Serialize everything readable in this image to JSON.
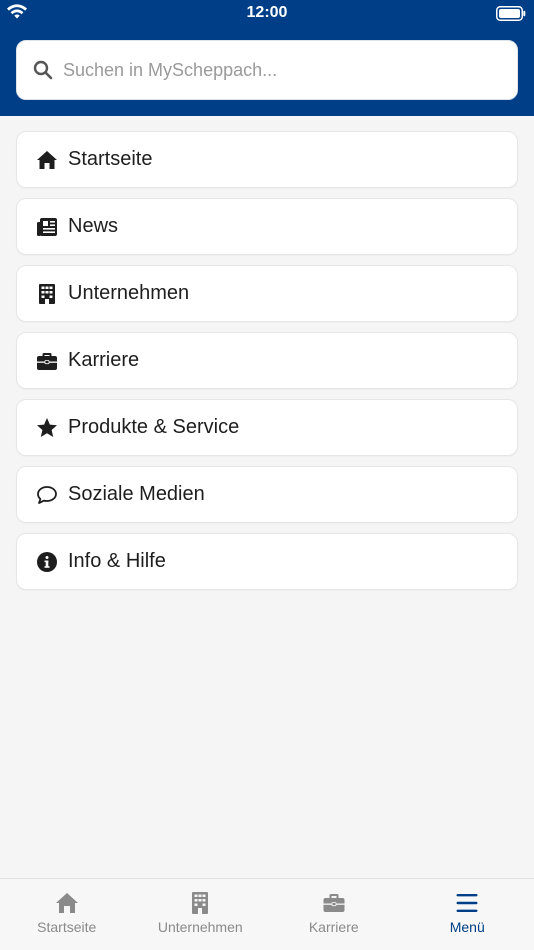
{
  "status_bar": {
    "time": "12:00"
  },
  "search": {
    "placeholder": "Suchen in MyScheppach..."
  },
  "menu": {
    "items": [
      {
        "label": "Startseite",
        "icon": "home-icon"
      },
      {
        "label": "News",
        "icon": "newspaper-icon"
      },
      {
        "label": "Unternehmen",
        "icon": "building-icon"
      },
      {
        "label": "Karriere",
        "icon": "briefcase-icon"
      },
      {
        "label": "Produkte & Service",
        "icon": "star-icon"
      },
      {
        "label": "Soziale Medien",
        "icon": "chat-bubble-icon"
      },
      {
        "label": "Info & Hilfe",
        "icon": "info-icon"
      }
    ]
  },
  "tabbar": {
    "tabs": [
      {
        "label": "Startseite",
        "icon": "home-icon",
        "active": false
      },
      {
        "label": "Unternehmen",
        "icon": "building-icon",
        "active": false
      },
      {
        "label": "Karriere",
        "icon": "briefcase-icon",
        "active": false
      },
      {
        "label": "Menü",
        "icon": "menu-icon",
        "active": true
      }
    ]
  },
  "colors": {
    "header_bg": "#003f87",
    "active_tab": "#003f87",
    "inactive_tab": "#8a8a8a",
    "page_bg": "#f5f5f5"
  }
}
